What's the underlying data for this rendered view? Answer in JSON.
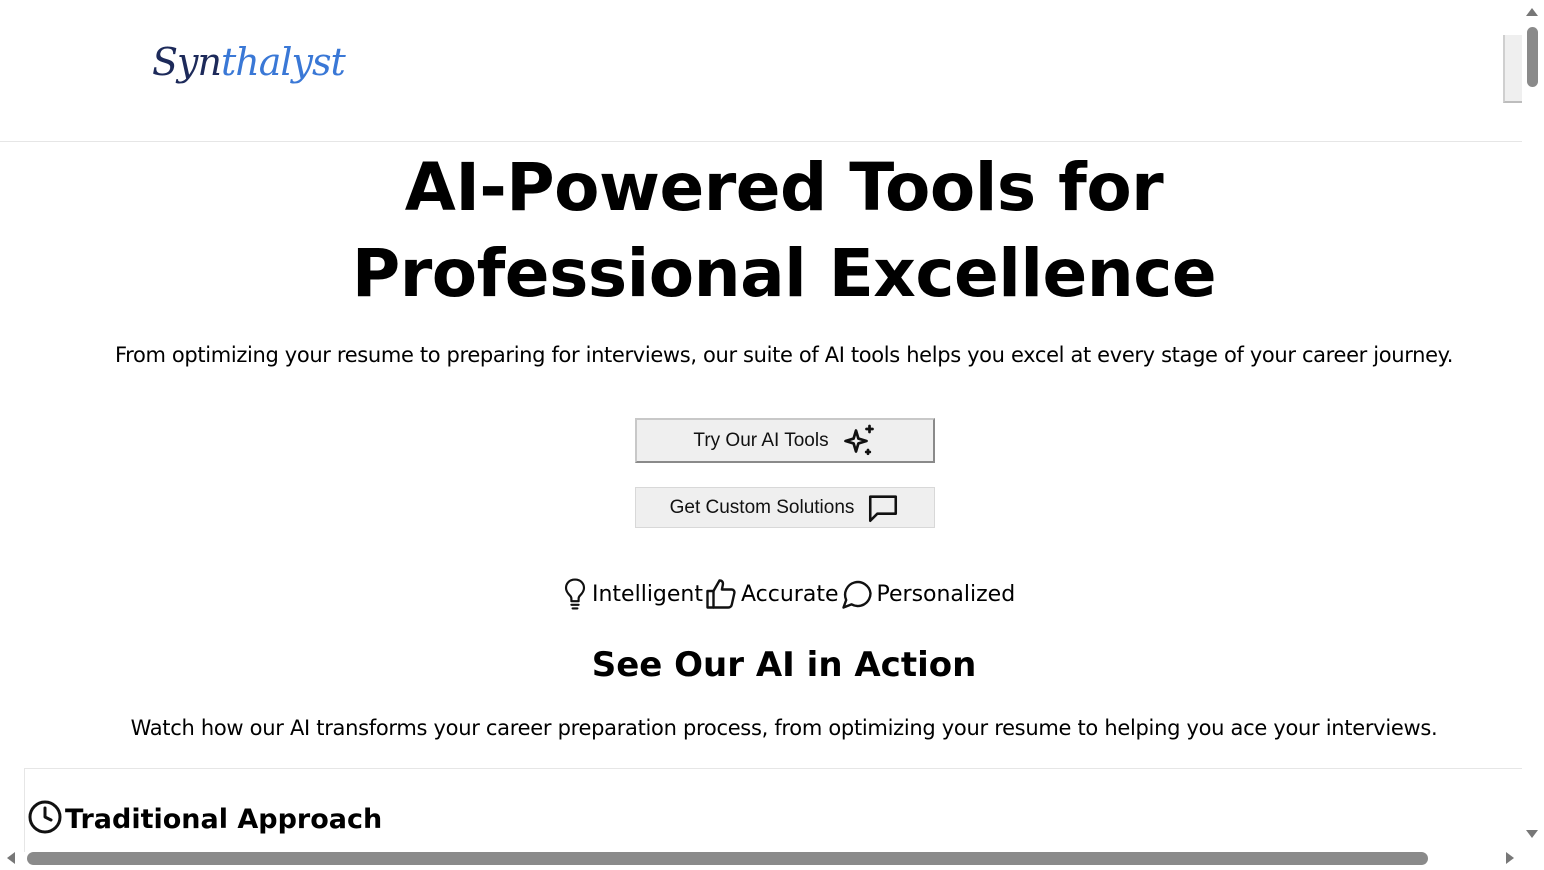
{
  "header": {
    "logo_part1": "Syn",
    "logo_part2": "thalyst"
  },
  "hero": {
    "title_line1": "AI-Powered Tools for",
    "title_line2": "Professional Excellence",
    "subtitle": "From optimizing your resume to preparing for interviews, our suite of AI tools helps you excel at every stage of your career journey.",
    "primary_button": {
      "label": "Try Our AI Tools",
      "icon": "sparkles-icon"
    },
    "secondary_button": {
      "label": "Get Custom Solutions",
      "icon": "message-square-icon"
    },
    "features": [
      {
        "label": "Intelligent",
        "icon": "lightbulb-icon"
      },
      {
        "label": "Accurate",
        "icon": "thumbs-up-icon"
      },
      {
        "label": "Personalized",
        "icon": "message-circle-icon"
      }
    ]
  },
  "demo": {
    "title": "See Our AI in Action",
    "subtitle": "Watch how our AI transforms your career preparation process, from optimizing your resume to helping you ace your interviews.",
    "card_title": "Traditional Approach",
    "card_icon": "clock-icon"
  },
  "colors": {
    "logo_dark": "#1d2a5a",
    "logo_accent": "#3a78d6",
    "button_bg": "#efefef",
    "scrollbar_thumb": "#8a8a8a"
  }
}
